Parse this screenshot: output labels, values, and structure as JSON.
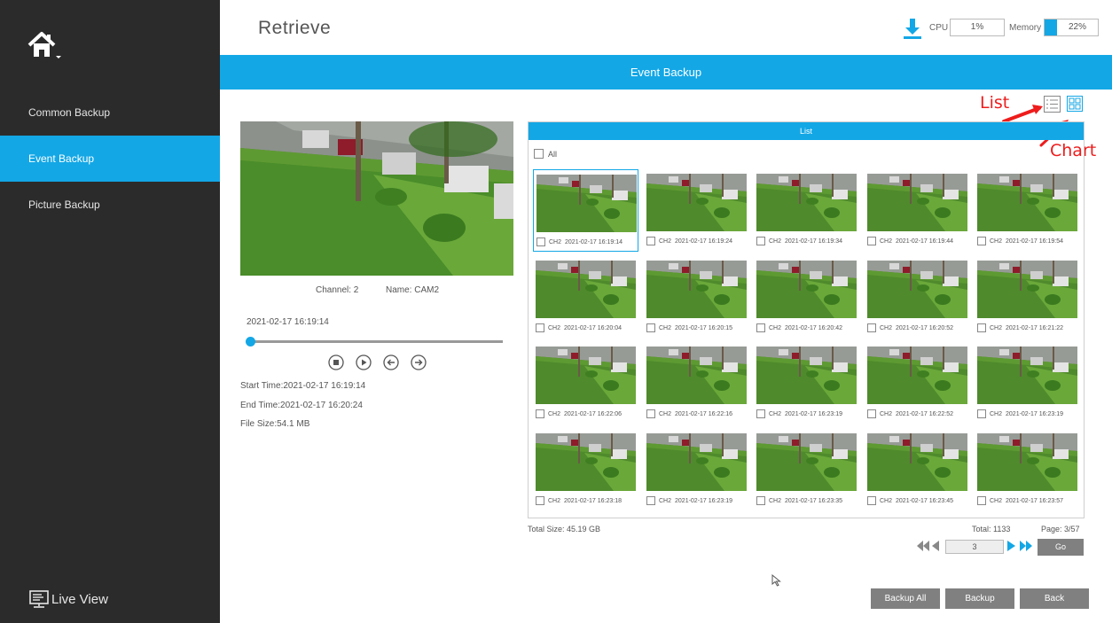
{
  "sidebar": {
    "items": [
      {
        "label": "Common Backup"
      },
      {
        "label": "Event Backup"
      },
      {
        "label": "Picture Backup"
      }
    ],
    "live_view": "Live View"
  },
  "header": {
    "title": "Retrieve",
    "cpu_label": "CPU",
    "cpu_value": "1%",
    "memory_label": "Memory",
    "memory_value": "22%",
    "memory_fraction": 0.22
  },
  "section": {
    "title": "Event Backup"
  },
  "annotations": {
    "list": "List",
    "chart": "Chart"
  },
  "preview": {
    "channel": "Channel: 2",
    "name": "Name: CAM2",
    "timestamp": "2021-02-17 16:19:14",
    "progress": 0,
    "start_time": "Start Time:2021-02-17 16:19:14",
    "end_time": "End Time:2021-02-17 16:20:24",
    "file_size": "File Size:54.1 MB"
  },
  "list": {
    "header": "List",
    "all_label": "All",
    "items": [
      {
        "ch": "CH2",
        "time": "2021-02-17 16:19:14"
      },
      {
        "ch": "CH2",
        "time": "2021-02-17 16:19:24"
      },
      {
        "ch": "CH2",
        "time": "2021-02-17 16:19:34"
      },
      {
        "ch": "CH2",
        "time": "2021-02-17 16:19:44"
      },
      {
        "ch": "CH2",
        "time": "2021-02-17 16:19:54"
      },
      {
        "ch": "CH2",
        "time": "2021-02-17 16:20:04"
      },
      {
        "ch": "CH2",
        "time": "2021-02-17 16:20:15"
      },
      {
        "ch": "CH2",
        "time": "2021-02-17 16:20:42"
      },
      {
        "ch": "CH2",
        "time": "2021-02-17 16:20:52"
      },
      {
        "ch": "CH2",
        "time": "2021-02-17 16:21:22"
      },
      {
        "ch": "CH2",
        "time": "2021-02-17 16:22:06"
      },
      {
        "ch": "CH2",
        "time": "2021-02-17 16:22:16"
      },
      {
        "ch": "CH2",
        "time": "2021-02-17 16:23:19"
      },
      {
        "ch": "CH2",
        "time": "2021-02-17 16:22:52"
      },
      {
        "ch": "CH2",
        "time": "2021-02-17 16:23:19"
      },
      {
        "ch": "CH2",
        "time": "2021-02-17 16:23:18"
      },
      {
        "ch": "CH2",
        "time": "2021-02-17 16:23:19"
      },
      {
        "ch": "CH2",
        "time": "2021-02-17 16:23:35"
      },
      {
        "ch": "CH2",
        "time": "2021-02-17 16:23:45"
      },
      {
        "ch": "CH2",
        "time": "2021-02-17 16:23:57"
      }
    ],
    "total_size": "Total Size: 45.19 GB",
    "total": "Total: 1133",
    "page": "Page: 3/57",
    "page_input": "3",
    "go_label": "Go"
  },
  "buttons": {
    "backup_all": "Backup All",
    "backup": "Backup",
    "back": "Back"
  },
  "colors": {
    "accent": "#13a7e6",
    "sidebar": "#2b2b2b",
    "button": "#808080",
    "annotation": "#ee1c1c"
  }
}
